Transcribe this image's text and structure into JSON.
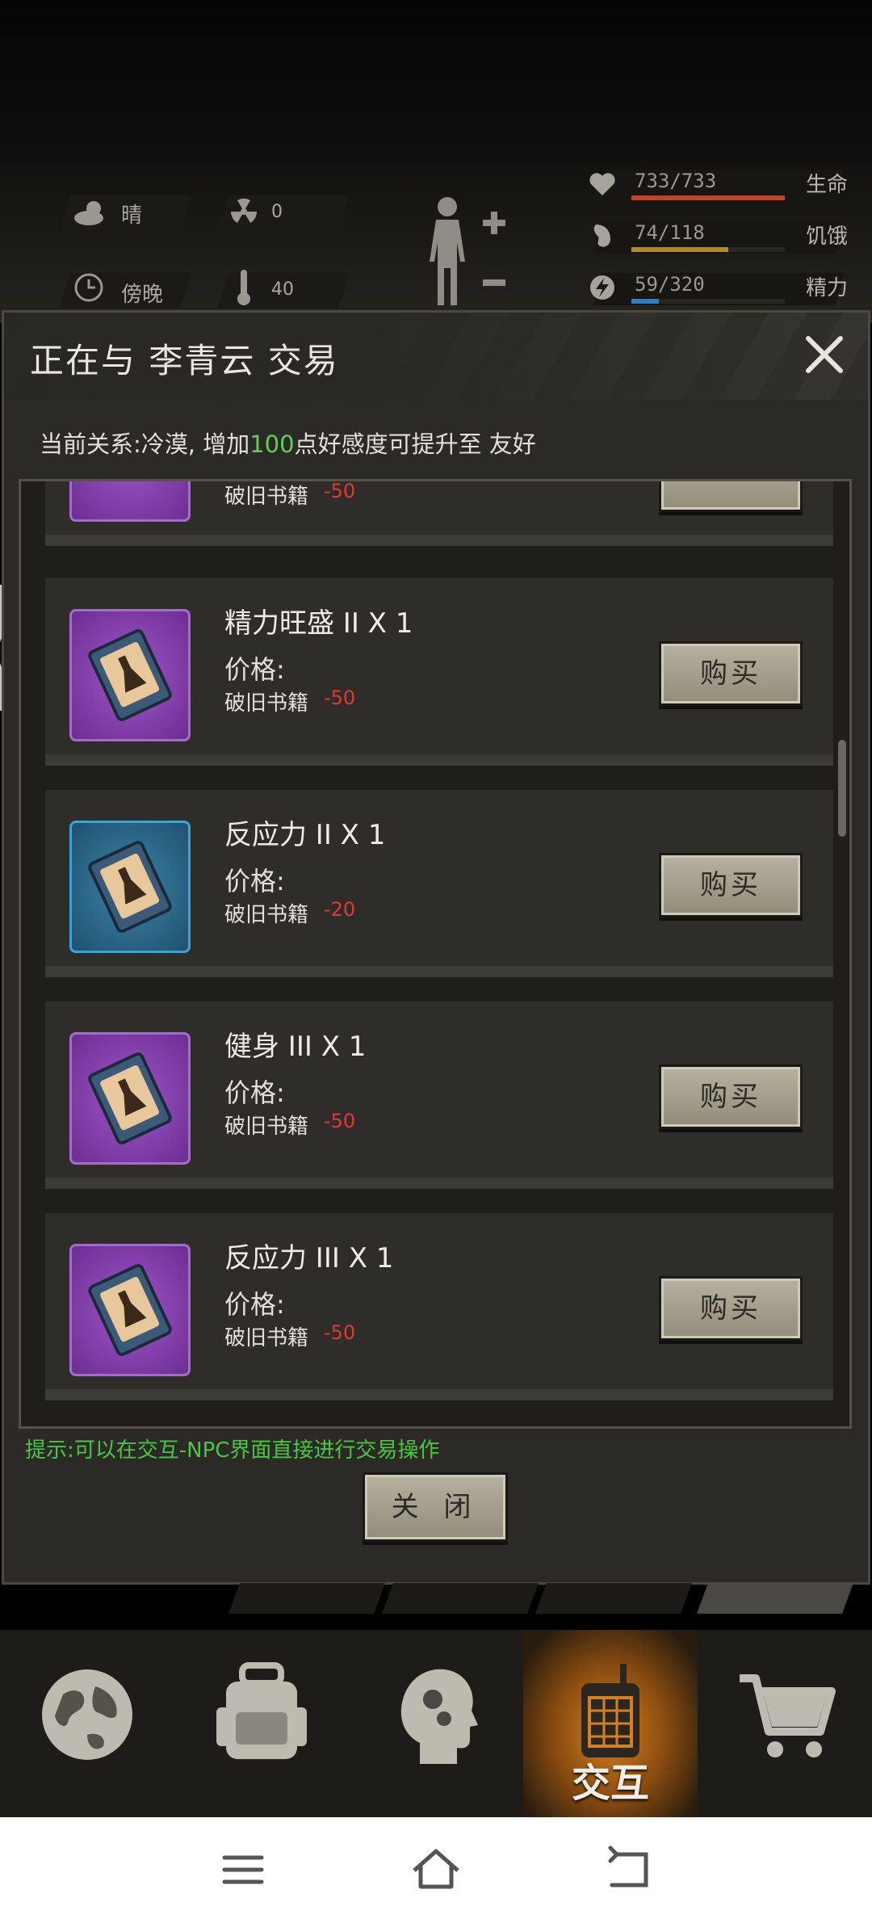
{
  "hud": {
    "weather": "晴",
    "radiation": "0",
    "time_of_day": "傍晚",
    "temperature": "40",
    "stats": [
      {
        "icon": "heart-icon",
        "value": "733/733",
        "label": "生命",
        "fraction": 1.0,
        "color": "#c0432e"
      },
      {
        "icon": "stomach-icon",
        "value": "74/118",
        "label": "饥饿",
        "fraction": 0.63,
        "color": "#b08a2c"
      },
      {
        "icon": "energy-icon",
        "value": "59/320",
        "label": "精力",
        "fraction": 0.18,
        "color": "#2e7fc0"
      }
    ]
  },
  "modal": {
    "title": "正在与 李青云 交易",
    "relation_prefix": "当前关系:冷漠, 增加",
    "relation_points": "100",
    "relation_suffix": "点好感度可提升至 友好",
    "partial_item": {
      "currency": "破旧书籍",
      "cost": "-50"
    },
    "items": [
      {
        "name": "精力旺盛 II  X 1",
        "price_label": "价格:",
        "currency": "破旧书籍",
        "cost": "-50",
        "thumb": "purple",
        "buy_label": "购买"
      },
      {
        "name": "反应力 II  X 1",
        "price_label": "价格:",
        "currency": "破旧书籍",
        "cost": "-20",
        "thumb": "blue",
        "buy_label": "购买"
      },
      {
        "name": "健身 III  X 1",
        "price_label": "价格:",
        "currency": "破旧书籍",
        "cost": "-50",
        "thumb": "purple",
        "buy_label": "购买"
      },
      {
        "name": "反应力 III  X 1",
        "price_label": "价格:",
        "currency": "破旧书籍",
        "cost": "-50",
        "thumb": "purple",
        "buy_label": "购买"
      }
    ],
    "hint": "提示:可以在交互-NPC界面直接进行交易操作",
    "close_label": "关 闭"
  },
  "bottom_nav": {
    "items": [
      {
        "icon": "globe-icon",
        "label": ""
      },
      {
        "icon": "backpack-icon",
        "label": ""
      },
      {
        "icon": "head-gears-icon",
        "label": ""
      },
      {
        "icon": "radio-icon",
        "label": "交互",
        "active": true
      },
      {
        "icon": "cart-icon",
        "label": ""
      }
    ]
  }
}
